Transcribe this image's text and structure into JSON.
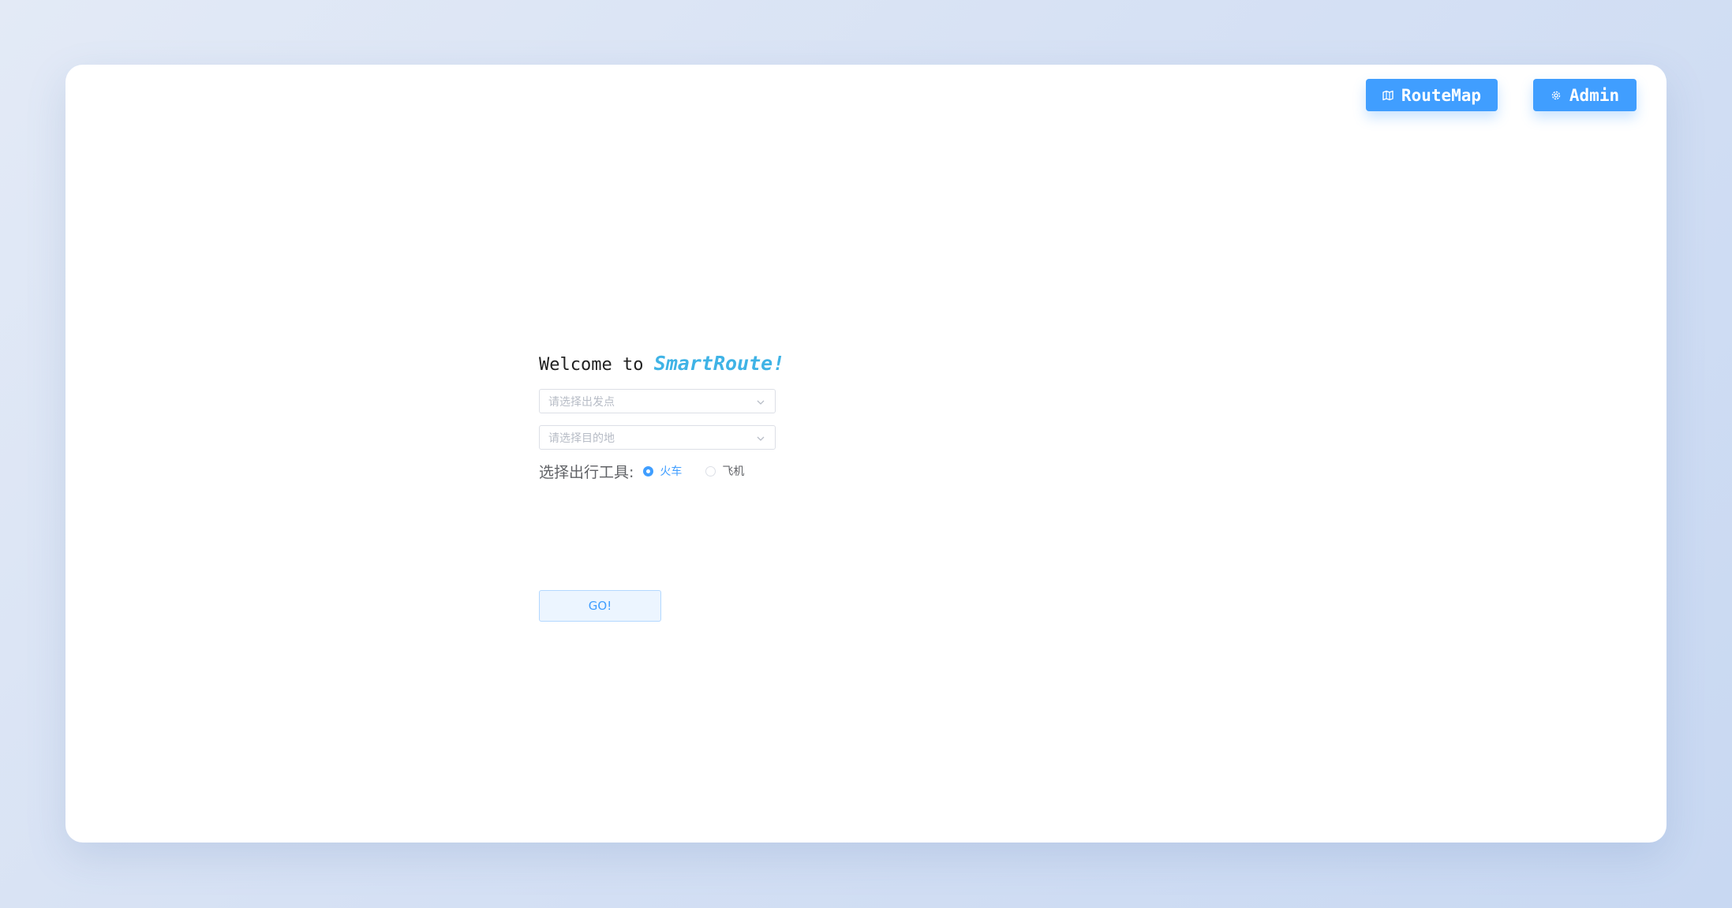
{
  "header": {
    "routemap_label": "RouteMap",
    "routemap_icon": "map-icon",
    "admin_label": "Admin",
    "admin_icon": "gear-icon"
  },
  "welcome": {
    "prefix": "Welcome to ",
    "brand": "SmartRoute!"
  },
  "form": {
    "start_placeholder": "请选择出发点",
    "destination_placeholder": "请选择目的地",
    "transport_label": "选择出行工具:",
    "transport_options": [
      {
        "label": "火车",
        "selected": true
      },
      {
        "label": "飞机",
        "selected": false
      }
    ],
    "go_label": "GO!"
  },
  "colors": {
    "primary": "#409eff",
    "brand": "#3fb3e6",
    "background": "#d6e1f4"
  }
}
